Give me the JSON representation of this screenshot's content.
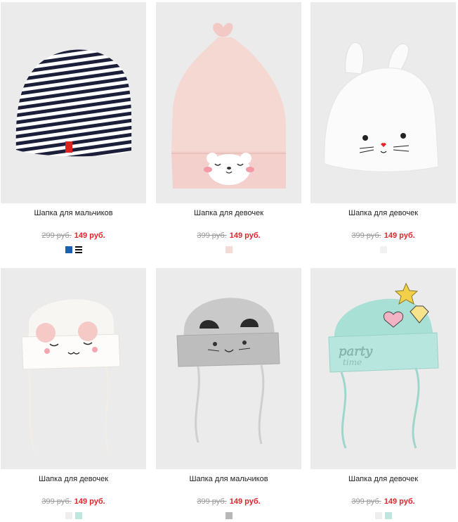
{
  "products": [
    {
      "name": "Шапка для мальчиков",
      "old_price": "299 руб.",
      "new_price": "149 руб.",
      "swatches": [
        {
          "color": "#1a5fb4",
          "type": "solid"
        },
        {
          "color": "#111111",
          "type": "stripes"
        }
      ]
    },
    {
      "name": "Шапка для девочек",
      "old_price": "399 руб.",
      "new_price": "149 руб.",
      "swatches": [
        {
          "color": "#f3dcd8",
          "type": "solid"
        }
      ]
    },
    {
      "name": "Шапка для девочек",
      "old_price": "399 руб.",
      "new_price": "149 руб.",
      "swatches": [
        {
          "color": "#f2f2f2",
          "type": "solid"
        }
      ]
    },
    {
      "name": "Шапка для девочек",
      "old_price": "399 руб.",
      "new_price": "149 руб.",
      "swatches": [
        {
          "color": "#eeeeee",
          "type": "solid"
        },
        {
          "color": "#bfe6dd",
          "type": "solid"
        }
      ]
    },
    {
      "name": "Шапка для мальчиков",
      "old_price": "399 руб.",
      "new_price": "149 руб.",
      "swatches": [
        {
          "color": "#b8b8b8",
          "type": "solid"
        }
      ]
    },
    {
      "name": "Шапка для девочек",
      "old_price": "399 руб.",
      "new_price": "149 руб.",
      "swatches": [
        {
          "color": "#eeeeee",
          "type": "solid"
        },
        {
          "color": "#bfe6dd",
          "type": "solid"
        }
      ]
    }
  ],
  "hat_texts": {
    "party": "party",
    "time": "time"
  },
  "colors": {
    "price_new": "#e0242b",
    "price_old": "#999999",
    "photo_bg": "#ebebeb"
  }
}
